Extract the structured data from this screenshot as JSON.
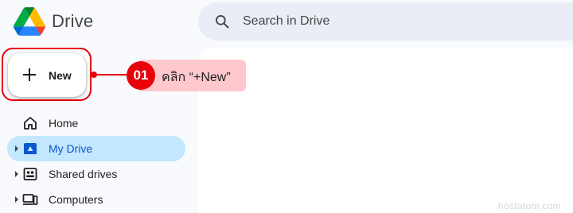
{
  "app": {
    "title": "Drive"
  },
  "search": {
    "placeholder": "Search in Drive"
  },
  "new_button": {
    "label": "New"
  },
  "annotation": {
    "step": "01",
    "text": "คลิก “+New”"
  },
  "sidebar": {
    "items": [
      {
        "label": "Home",
        "icon": "home-icon",
        "active": false,
        "expandable": false
      },
      {
        "label": "My Drive",
        "icon": "my-drive-icon",
        "active": true,
        "expandable": true
      },
      {
        "label": "Shared drives",
        "icon": "shared-drives-icon",
        "active": false,
        "expandable": true
      },
      {
        "label": "Computers",
        "icon": "computers-icon",
        "active": false,
        "expandable": true
      }
    ]
  },
  "watermark": "hostatom.com",
  "colors": {
    "background": "#f8fafd",
    "search_bg": "#e9eef6",
    "active_nav_bg": "#c2e7ff",
    "active_nav_text": "#0b57d0",
    "annotation_red": "#e8000b",
    "callout_bg": "#ffc8cc"
  }
}
